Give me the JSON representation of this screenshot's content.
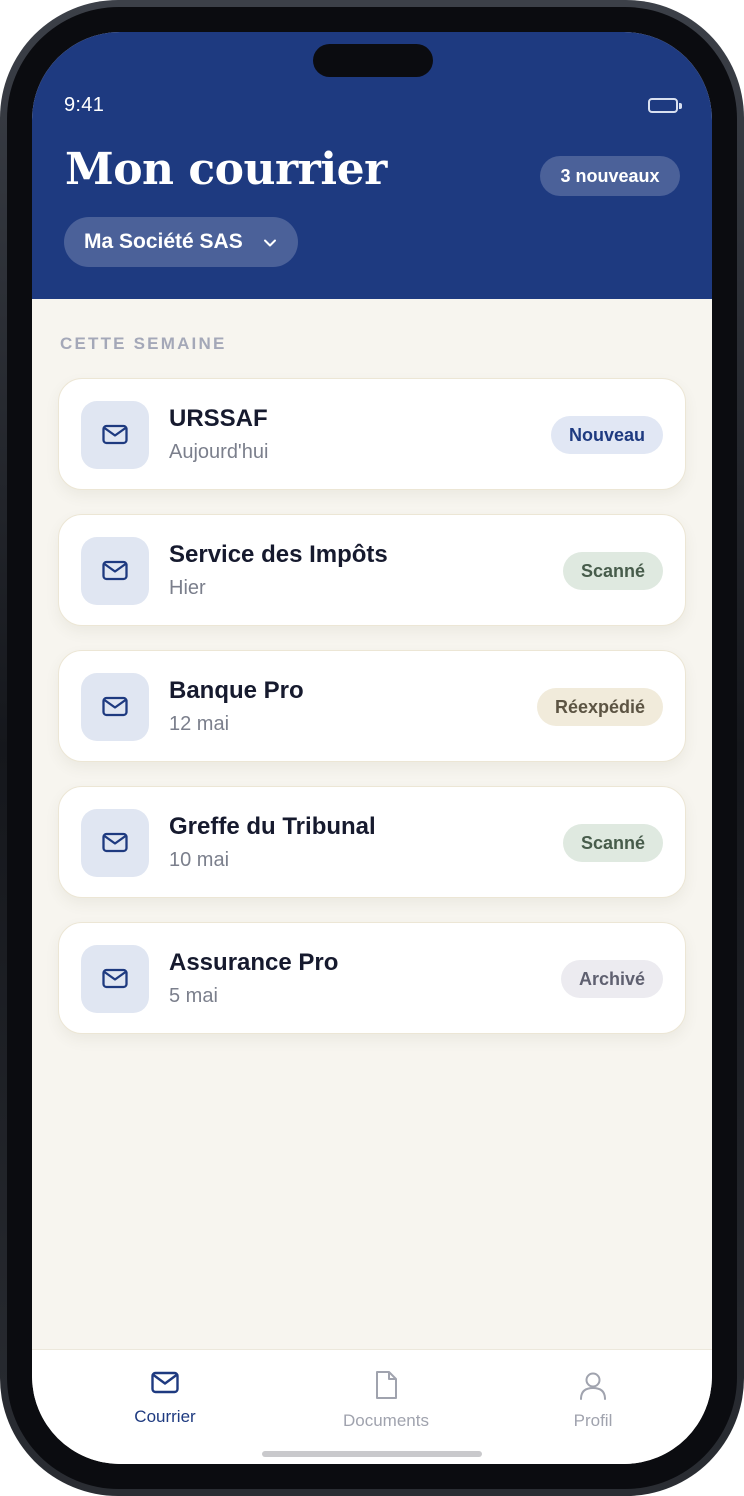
{
  "status_bar": {
    "time": "9:41"
  },
  "header": {
    "title": "Mon courrier",
    "new_count_label": "3 nouveaux",
    "company_selector": "Ma Société SAS"
  },
  "section_label": "CETTE SEMAINE",
  "mail_items": [
    {
      "sender": "URSSAF",
      "date": "Aujourd'hui",
      "status": "Nouveau",
      "icon": "envelope-icon"
    },
    {
      "sender": "Service des Impôts",
      "date": "Hier",
      "status": "Scanné",
      "icon": "envelope-icon"
    },
    {
      "sender": "Banque Pro",
      "date": "12 mai",
      "status": "Réexpédié",
      "icon": "envelope-icon"
    },
    {
      "sender": "Greffe du Tribunal",
      "date": "10 mai",
      "status": "Scanné",
      "icon": "envelope-icon"
    },
    {
      "sender": "Assurance Pro",
      "date": "5 mai",
      "status": "Archivé",
      "icon": "envelope-icon"
    }
  ],
  "status_colors": {
    "Nouveau": {
      "bg": "#e1e7f4",
      "fg": "#1e3a80"
    },
    "Scanné": {
      "bg": "#dfe9e0",
      "fg": "#475c4b"
    },
    "Réexpédié": {
      "bg": "#f1ebdb",
      "fg": "#5c5443"
    },
    "Archivé": {
      "bg": "#ecebf0",
      "fg": "#5f6070"
    }
  },
  "tab_bar": {
    "tabs": [
      {
        "label": "Courrier",
        "icon": "envelope-icon",
        "active": true
      },
      {
        "label": "Documents",
        "icon": "document-icon",
        "active": false
      },
      {
        "label": "Profil",
        "icon": "user-icon",
        "active": false
      }
    ]
  },
  "colors": {
    "header_bg": "#1e3a80",
    "screen_bg": "#f7f5ef",
    "accent": "#1e3a80",
    "tab_inactive": "#a0a3ae"
  }
}
